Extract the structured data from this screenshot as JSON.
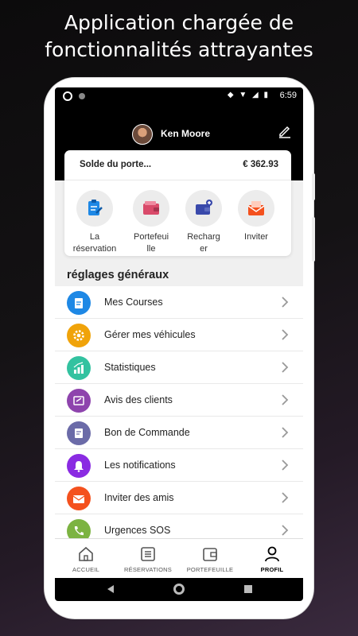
{
  "headline": {
    "line1": "Application chargée de",
    "line2": "fonctionnalités attrayantes"
  },
  "statusbar": {
    "time": "6:59",
    "icons": "◆ ▼ ◢ ▮"
  },
  "profile": {
    "name": "Ken Moore"
  },
  "wallet": {
    "balance_label": "Solde du porte...",
    "balance_value": "€ 362.93",
    "actions": [
      {
        "label_line1": "La",
        "label_line2": "réservation",
        "icon": "clipboard-icon",
        "color": "#1e88e5"
      },
      {
        "label_line1": "Portefeui",
        "label_line2": "lle",
        "icon": "wallet-icon",
        "color": "#d94a6a"
      },
      {
        "label_line1": "Recharg",
        "label_line2": "er",
        "icon": "wallet-plus-icon",
        "color": "#3949ab"
      },
      {
        "label_line1": "Inviter",
        "label_line2": "",
        "icon": "envelope-icon",
        "color": "#f4511e"
      }
    ]
  },
  "settings": {
    "title": "réglages généraux",
    "items": [
      {
        "label": "Mes Courses",
        "icon": "clipboard-icon",
        "color": "#1e88e5"
      },
      {
        "label": "Gérer mes véhicules",
        "icon": "gear-icon",
        "color": "#f0a30a"
      },
      {
        "label": "Statistiques",
        "icon": "bar-chart-icon",
        "color": "#33c2a0"
      },
      {
        "label": "Avis des clients",
        "icon": "review-icon",
        "color": "#8e44ad"
      },
      {
        "label": "Bon de Commande",
        "icon": "receipt-icon",
        "color": "#6b6ba8"
      },
      {
        "label": "Les notifications",
        "icon": "bell-icon",
        "color": "#8a2be2"
      },
      {
        "label": "Inviter des amis",
        "icon": "envelope-icon",
        "color": "#f4511e"
      },
      {
        "label": "Urgences SOS",
        "icon": "phone-icon",
        "color": "#7cb342"
      }
    ]
  },
  "bottomnav": {
    "items": [
      {
        "label": "ACCUEIL",
        "icon": "home-icon"
      },
      {
        "label": "RÉSERVATIONS",
        "icon": "list-icon"
      },
      {
        "label": "PORTEFEUILLE",
        "icon": "wallet-icon"
      },
      {
        "label": "PROFIL",
        "icon": "person-icon",
        "active": true
      }
    ]
  }
}
